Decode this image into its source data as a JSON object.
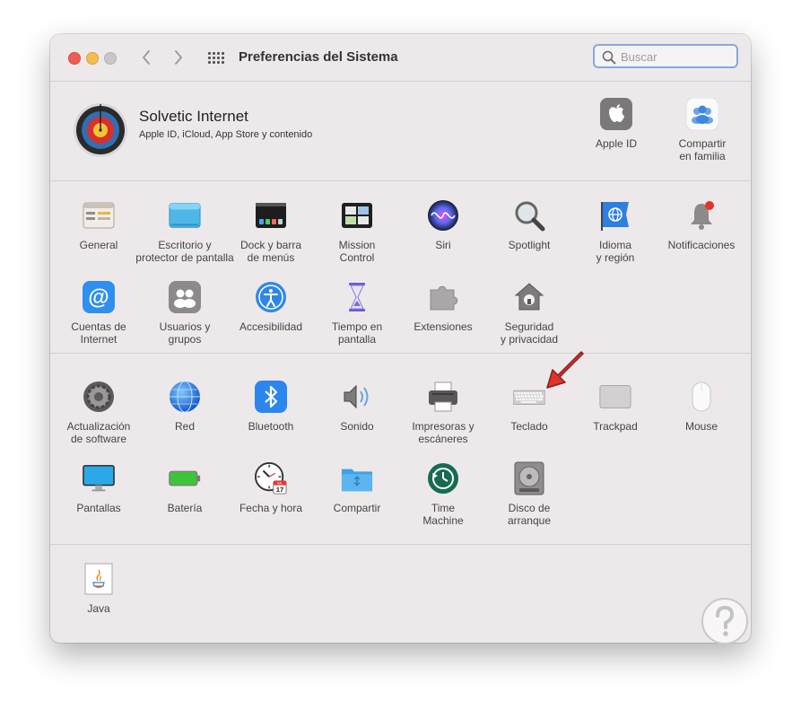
{
  "window": {
    "title": "Preferencias del Sistema",
    "search_placeholder": "Buscar"
  },
  "account": {
    "name": "Solvetic Internet",
    "subtitle": "Apple ID, iCloud, App Store y contenido",
    "items": [
      {
        "label": "Apple ID",
        "icon": "apple-icon"
      },
      {
        "label": "Compartir\nen familia",
        "icon": "family-icon"
      }
    ]
  },
  "section1": [
    {
      "label": "General",
      "icon": "general-icon"
    },
    {
      "label": "Escritorio y\nprotector de pantalla",
      "icon": "desktop-icon"
    },
    {
      "label": "Dock y barra\nde menús",
      "icon": "dock-icon"
    },
    {
      "label": "Mission\nControl",
      "icon": "mission-control-icon"
    },
    {
      "label": "Siri",
      "icon": "siri-icon"
    },
    {
      "label": "Spotlight",
      "icon": "spotlight-icon"
    },
    {
      "label": "Idioma\ny región",
      "icon": "flag-icon"
    },
    {
      "label": "Notificaciones",
      "icon": "bell-icon"
    },
    {
      "label": "Cuentas de\nInternet",
      "icon": "at-icon"
    },
    {
      "label": "Usuarios y\ngrupos",
      "icon": "users-icon"
    },
    {
      "label": "Accesibilidad",
      "icon": "accessibility-icon"
    },
    {
      "label": "Tiempo en\npantalla",
      "icon": "hourglass-icon"
    },
    {
      "label": "Extensiones",
      "icon": "puzzle-icon"
    },
    {
      "label": "Seguridad\ny privacidad",
      "icon": "house-lock-icon"
    }
  ],
  "section2": [
    {
      "label": "Actualización\nde software",
      "icon": "gear-icon"
    },
    {
      "label": "Red",
      "icon": "globe-icon"
    },
    {
      "label": "Bluetooth",
      "icon": "bluetooth-icon"
    },
    {
      "label": "Sonido",
      "icon": "speaker-icon"
    },
    {
      "label": "Impresoras y\nescáneres",
      "icon": "printer-icon"
    },
    {
      "label": "Teclado",
      "icon": "keyboard-icon"
    },
    {
      "label": "Trackpad",
      "icon": "trackpad-icon"
    },
    {
      "label": "Mouse",
      "icon": "mouse-icon"
    },
    {
      "label": "Pantallas",
      "icon": "display-icon"
    },
    {
      "label": "Batería",
      "icon": "battery-icon"
    },
    {
      "label": "Fecha y hora",
      "icon": "clock-icon"
    },
    {
      "label": "Compartir",
      "icon": "folder-icon"
    },
    {
      "label": "Time\nMachine",
      "icon": "time-machine-icon"
    },
    {
      "label": "Disco de\narranque",
      "icon": "disk-icon"
    }
  ],
  "section3": [
    {
      "label": "Java",
      "icon": "java-icon"
    }
  ],
  "calendar_day": "17",
  "calendar_month": "JUL",
  "colors": {
    "window_bg": "#ede9ea",
    "accent_arrow": "#e0332c",
    "search_border": "#85a9dc"
  }
}
